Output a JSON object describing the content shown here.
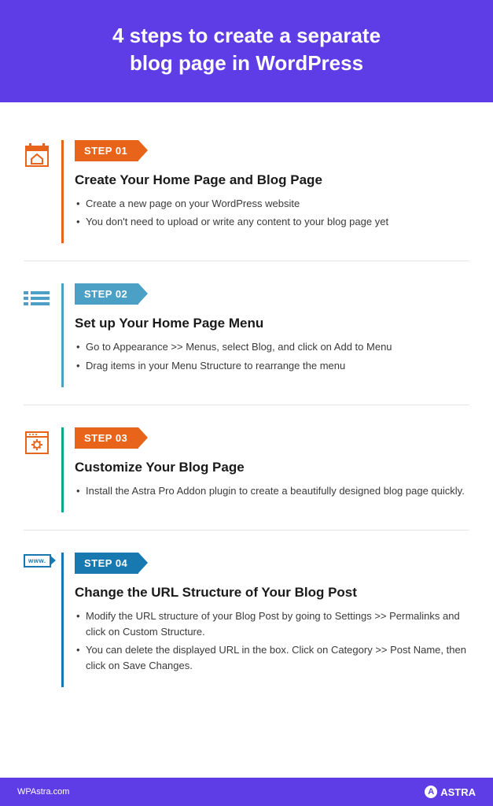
{
  "header": {
    "title_line1": "4 steps to create a separate",
    "title_line2": "blog page in WordPress"
  },
  "steps": [
    {
      "badge": "STEP 01",
      "title": "Create Your Home Page and Blog Page",
      "bullets": [
        "Create a new page on your WordPress website",
        "You don't need to upload or write any content to your blog page yet"
      ]
    },
    {
      "badge": "STEP 02",
      "title": "Set up Your Home Page Menu",
      "bullets": [
        "Go to Appearance >> Menus, select Blog, and click on Add to Menu",
        "Drag items in your Menu Structure to rearrange the menu"
      ]
    },
    {
      "badge": "STEP 03",
      "title": "Customize Your Blog Page",
      "bullets": [
        "Install the Astra Pro Addon plugin to create a beautifully designed blog page quickly."
      ]
    },
    {
      "badge": "STEP 04",
      "title": "Change the URL Structure of Your Blog Post",
      "bullets": [
        "Modify the URL structure of your Blog Post by going to Settings >> Permalinks and click on Custom Structure.",
        "You can delete the displayed URL in the box. Click on Category >> Post Name, then click on Save Changes."
      ]
    }
  ],
  "icons": {
    "www_label": "www."
  },
  "footer": {
    "site": "WPAstra.com",
    "brand": "ASTRA",
    "brand_letter": "A"
  }
}
